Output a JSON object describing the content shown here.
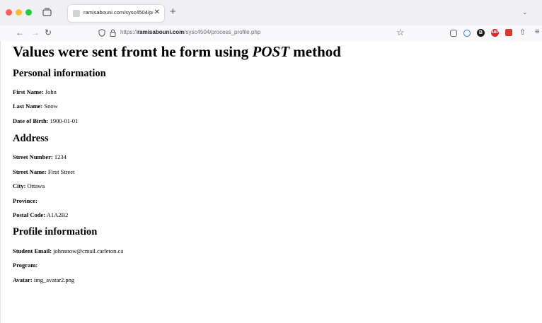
{
  "browser": {
    "tab_title": "ramisabouni.com/sysc4504/process_",
    "tab_close": "✕",
    "new_tab": "+",
    "list_tabs": "⌄",
    "url_prefix": "https://",
    "url_domain": "ramisabouni.com",
    "url_path": "/sysc4504/process_profile.php",
    "nav_back": "←",
    "nav_forward": "→",
    "nav_reload": "↻",
    "bookmark": "☆",
    "share": "⇧",
    "menu": "≡",
    "ext_b": "B",
    "ext_abp": "ABP"
  },
  "page": {
    "heading_pre": "Values were sent fromt he form using ",
    "heading_em": "POST",
    "heading_post": " method",
    "sections": {
      "personal": "Personal information",
      "address": "Address",
      "profile": "Profile information"
    },
    "fields": {
      "first_name": {
        "label": "First Name:",
        "value": " John"
      },
      "last_name": {
        "label": "Last Name:",
        "value": " Snow"
      },
      "dob": {
        "label": "Date of Birth:",
        "value": " 1900-01-01"
      },
      "street_number": {
        "label": "Street Number:",
        "value": " 1234"
      },
      "street_name": {
        "label": "Street Name:",
        "value": " First Street"
      },
      "city": {
        "label": "City:",
        "value": " Ottawa"
      },
      "province": {
        "label": "Province:",
        "value": ""
      },
      "postal_code": {
        "label": "Postal Code:",
        "value": " A1A2B2"
      },
      "email": {
        "label": "Student Email:",
        "value": " johnsnow@cmail.carleton.ca"
      },
      "program": {
        "label": "Program:",
        "value": ""
      },
      "avatar": {
        "label": "Avatar:",
        "value": " img_avatar2.png"
      }
    }
  }
}
